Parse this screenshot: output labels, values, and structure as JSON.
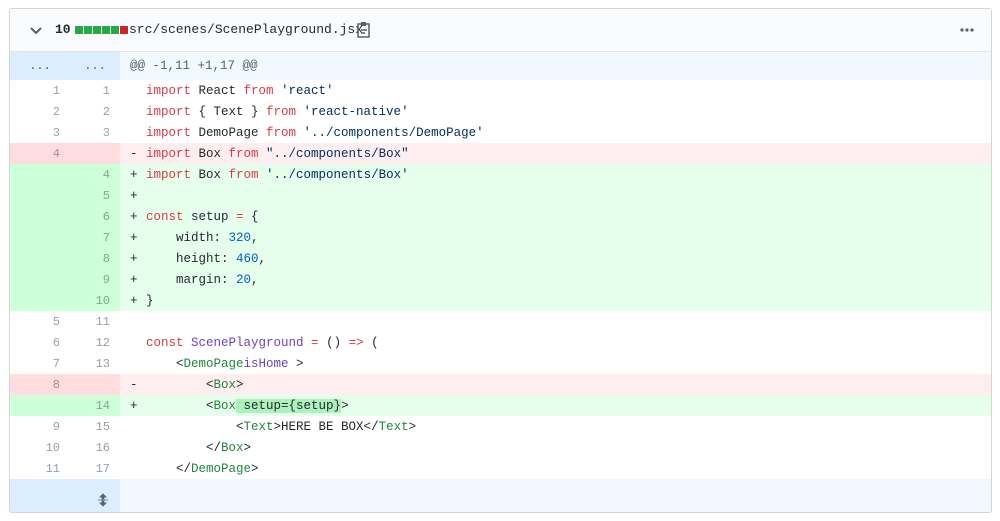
{
  "file": {
    "change_count": "10",
    "diffstat": [
      "#28a745",
      "#28a745",
      "#28a745",
      "#28a745",
      "#28a745",
      "#cb2431"
    ],
    "path": "src/scenes/ScenePlayground.jsx"
  },
  "hunk": {
    "old_marker": "...",
    "new_marker": "...",
    "header": "@@ -1,11 +1,17 @@"
  },
  "lines": [
    {
      "type": "ctx",
      "old": "1",
      "new": "1",
      "mark": " ",
      "tokens": [
        [
          "k",
          "import"
        ],
        [
          "",
          "React "
        ],
        [
          "k",
          "from"
        ],
        [
          "s",
          "'react'"
        ]
      ]
    },
    {
      "type": "ctx",
      "old": "2",
      "new": "2",
      "mark": " ",
      "tokens": [
        [
          "k",
          "import"
        ],
        [
          "",
          "{ Text } "
        ],
        [
          "k",
          "from"
        ],
        [
          "s",
          "'react-native'"
        ]
      ]
    },
    {
      "type": "ctx",
      "old": "3",
      "new": "3",
      "mark": " ",
      "tokens": [
        [
          "k",
          "import"
        ],
        [
          "",
          "DemoPage "
        ],
        [
          "k",
          "from"
        ],
        [
          "s",
          "'../components/DemoPage'"
        ]
      ]
    },
    {
      "type": "del",
      "old": "4",
      "new": "",
      "mark": "-",
      "tokens": [
        [
          "k",
          "import"
        ],
        [
          "",
          "Box "
        ],
        [
          "k",
          "from"
        ],
        [
          "s",
          "\"../components/Box\""
        ]
      ]
    },
    {
      "type": "add",
      "old": "",
      "new": "4",
      "mark": "+",
      "tokens": [
        [
          "k",
          "import"
        ],
        [
          "",
          "Box "
        ],
        [
          "k",
          "from"
        ],
        [
          "s",
          "'../components/Box'"
        ]
      ]
    },
    {
      "type": "add",
      "old": "",
      "new": "5",
      "mark": "+",
      "tokens": []
    },
    {
      "type": "add",
      "old": "",
      "new": "6",
      "mark": "+",
      "tokens": [
        [
          "k",
          "const"
        ],
        [
          "",
          "setup "
        ],
        [
          "k",
          "="
        ],
        [
          "",
          "{"
        ]
      ]
    },
    {
      "type": "add",
      "old": "",
      "new": "7",
      "mark": "+",
      "tokens": [
        [
          "",
          "    width: "
        ],
        [
          "n",
          "320"
        ],
        [
          "",
          ","
        ]
      ]
    },
    {
      "type": "add",
      "old": "",
      "new": "8",
      "mark": "+",
      "tokens": [
        [
          "",
          "    height: "
        ],
        [
          "n",
          "460"
        ],
        [
          "",
          ","
        ]
      ]
    },
    {
      "type": "add",
      "old": "",
      "new": "9",
      "mark": "+",
      "tokens": [
        [
          "",
          "    margin: "
        ],
        [
          "n",
          "20"
        ],
        [
          "",
          ","
        ]
      ]
    },
    {
      "type": "add",
      "old": "",
      "new": "10",
      "mark": "+",
      "tokens": [
        [
          "",
          "}"
        ]
      ]
    },
    {
      "type": "ctx",
      "old": "5",
      "new": "11",
      "mark": " ",
      "tokens": []
    },
    {
      "type": "ctx",
      "old": "6",
      "new": "12",
      "mark": " ",
      "tokens": [
        [
          "k",
          "const"
        ],
        [
          "f",
          "ScenePlayground"
        ],
        [
          "k",
          "="
        ],
        [
          "",
          "() "
        ],
        [
          "k",
          "=>"
        ],
        [
          "",
          "("
        ]
      ]
    },
    {
      "type": "ctx",
      "old": "7",
      "new": "13",
      "mark": " ",
      "tokens": [
        [
          "",
          "    <"
        ],
        [
          "t",
          "DemoPage"
        ],
        [
          "f",
          "isHome"
        ],
        [
          "",
          ">"
        ]
      ]
    },
    {
      "type": "del",
      "old": "8",
      "new": "",
      "mark": "-",
      "tokens": [
        [
          "",
          "        <"
        ],
        [
          "t",
          "Box"
        ],
        [
          "",
          ">"
        ]
      ]
    },
    {
      "type": "add",
      "old": "",
      "new": "14",
      "mark": "+",
      "tokens": [
        [
          "",
          "        <"
        ],
        [
          "t",
          "Box"
        ],
        [
          "hl",
          " setup={setup}"
        ],
        [
          "",
          ">"
        ]
      ]
    },
    {
      "type": "ctx",
      "old": "9",
      "new": "15",
      "mark": " ",
      "tokens": [
        [
          "",
          "            <"
        ],
        [
          "t",
          "Text"
        ],
        [
          "",
          ">HERE BE BOX</"
        ],
        [
          "t",
          "Text"
        ],
        [
          "",
          ">"
        ]
      ]
    },
    {
      "type": "ctx",
      "old": "10",
      "new": "16",
      "mark": " ",
      "tokens": [
        [
          "",
          "        </"
        ],
        [
          "t",
          "Box"
        ],
        [
          "",
          ">"
        ]
      ]
    },
    {
      "type": "ctx",
      "old": "11",
      "new": "17",
      "mark": " ",
      "tokens": [
        [
          "",
          "    </"
        ],
        [
          "t",
          "DemoPage"
        ],
        [
          "",
          ">"
        ]
      ]
    }
  ],
  "icons": {
    "collapse": "chevron-down-icon",
    "copy": "clipboard-icon",
    "menu": "kebab-horizontal-icon",
    "expand": "unfold-icon"
  }
}
